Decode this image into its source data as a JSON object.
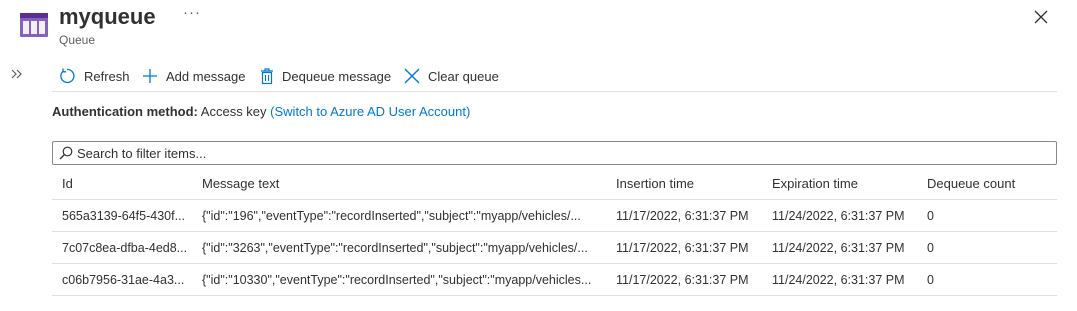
{
  "header": {
    "title": "myqueue",
    "subtitle": "Queue",
    "more": "···"
  },
  "toolbar": {
    "refresh": "Refresh",
    "add_message": "Add message",
    "dequeue_message": "Dequeue message",
    "clear_queue": "Clear queue"
  },
  "auth": {
    "label": "Authentication method:",
    "value": "Access key",
    "link": "(Switch to Azure AD User Account)"
  },
  "search": {
    "placeholder": "Search to filter items..."
  },
  "table": {
    "columns": [
      "Id",
      "Message text",
      "Insertion time",
      "Expiration time",
      "Dequeue count"
    ],
    "rows": [
      [
        "565a3139-64f5-430f...",
        "{\"id\":\"196\",\"eventType\":\"recordInserted\",\"subject\":\"myapp/vehicles/...",
        "11/17/2022, 6:31:37 PM",
        "11/24/2022, 6:31:37 PM",
        "0"
      ],
      [
        "7c07c8ea-dfba-4ed8...",
        "{\"id\":\"3263\",\"eventType\":\"recordInserted\",\"subject\":\"myapp/vehicles/...",
        "11/17/2022, 6:31:37 PM",
        "11/24/2022, 6:31:37 PM",
        "0"
      ],
      [
        "c06b7956-31ae-4a3...",
        "{\"id\":\"10330\",\"eventType\":\"recordInserted\",\"subject\":\"myapp/vehicles...",
        "11/17/2022, 6:31:37 PM",
        "11/24/2022, 6:31:37 PM",
        "0"
      ]
    ]
  },
  "colors": {
    "accent": "#0078d4",
    "queue_icon": "#8661c5",
    "text": "#323130",
    "border": "#e1dfdd"
  },
  "icons": [
    "queue-icon",
    "more-icon",
    "close-icon",
    "expand-icon",
    "refresh-icon",
    "add-icon",
    "trash-icon",
    "clear-icon",
    "search-icon"
  ]
}
